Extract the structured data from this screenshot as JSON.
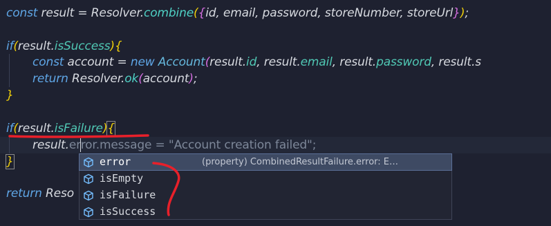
{
  "editor": {
    "line1": {
      "t1": "const",
      "t2": " result ",
      "t3": "=",
      "t4": " Resolver",
      "t5": ".",
      "t6": "combine",
      "t7": "(",
      "t8": "{",
      "t9": "id, email, password, storeNumber, storeUrl",
      "t10": "}",
      "t11": ")",
      "t12": ";"
    },
    "line3": {
      "t1": "if",
      "t2": "(",
      "t3": "result",
      "t4": ".",
      "t5": "isSuccess",
      "t6": ")",
      "t7": "{"
    },
    "line4": {
      "t1": "const",
      "t2": " account ",
      "t3": "=",
      "t4": " new ",
      "t5": "Account",
      "t6": "(",
      "t7": "result",
      "t8": ".",
      "t9": "id",
      "t10": ", result",
      "t11": ".",
      "t12": "email",
      "t13": ", result",
      "t14": ".",
      "t15": "password",
      "t16": ", result",
      "t17": ".s"
    },
    "line5": {
      "t1": "return",
      "t2": " Resolver",
      "t3": ".",
      "t4": "ok",
      "t5": "(",
      "t6": "account",
      "t7": ")",
      "t8": ";"
    },
    "line6": {
      "t1": "}"
    },
    "line8": {
      "t1": "if",
      "t2": "(",
      "t3": "result",
      "t4": ".",
      "t5": "isFailure",
      "t6": ")",
      "t7": "{"
    },
    "line9": {
      "t1": "result",
      "t2": ".",
      "t3": "error.message = \"Account creation failed\";"
    },
    "line10": {
      "t1": "}"
    },
    "line12": {
      "t1": "return",
      "t2": " Reso"
    }
  },
  "suggest": {
    "items": [
      {
        "label": "error",
        "detail": "(property) CombinedResultFailure.error: E…"
      },
      {
        "label": "isEmpty"
      },
      {
        "label": "isFailure"
      },
      {
        "label": "isSuccess"
      }
    ],
    "icon": "property-cube-icon"
  },
  "colors": {
    "background": "#1e2130",
    "keyword": "#5fa6e6",
    "annotation": "#e8202a"
  }
}
